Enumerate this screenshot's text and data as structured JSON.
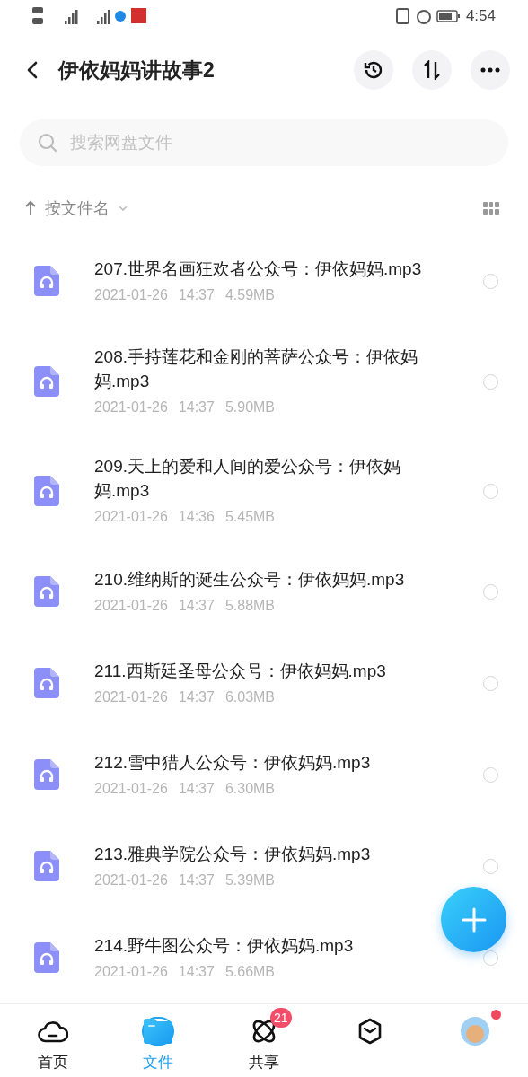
{
  "status_bar": {
    "time": "4:54"
  },
  "header": {
    "title": "伊依妈妈讲故事2"
  },
  "search": {
    "placeholder": "搜索网盘文件"
  },
  "sort": {
    "label": "按文件名"
  },
  "files": [
    {
      "name": "207.世界名画狂欢者公众号：伊依妈妈.mp3",
      "date": "2021-01-26",
      "time": "14:37",
      "size": "4.59MB",
      "selected": false
    },
    {
      "name": "208.手持莲花和金刚的菩萨公众号：伊依妈妈.mp3",
      "date": "2021-01-26",
      "time": "14:37",
      "size": "5.90MB",
      "selected": false
    },
    {
      "name": "209.天上的爱和人间的爱公众号：伊依妈妈.mp3",
      "date": "2021-01-26",
      "time": "14:36",
      "size": "5.45MB",
      "selected": false
    },
    {
      "name": "210.维纳斯的诞生公众号：伊依妈妈.mp3",
      "date": "2021-01-26",
      "time": "14:37",
      "size": "5.88MB",
      "selected": false
    },
    {
      "name": "211.西斯廷圣母公众号：伊依妈妈.mp3",
      "date": "2021-01-26",
      "time": "14:37",
      "size": "6.03MB",
      "selected": false
    },
    {
      "name": "212.雪中猎人公众号：伊依妈妈.mp3",
      "date": "2021-01-26",
      "time": "14:37",
      "size": "6.30MB",
      "selected": false
    },
    {
      "name": "213.雅典学院公众号：伊依妈妈.mp3",
      "date": "2021-01-26",
      "time": "14:37",
      "size": "5.39MB",
      "selected": false
    },
    {
      "name": "214.野牛图公众号：伊依妈妈.mp3",
      "date": "2021-01-26",
      "time": "14:37",
      "size": "5.66MB",
      "selected": false
    }
  ],
  "nav": [
    {
      "kind": "home",
      "label": "首页",
      "selected": false
    },
    {
      "kind": "files",
      "label": "文件",
      "selected": true
    },
    {
      "kind": "share",
      "label": "共享",
      "selected": false,
      "badge": "21"
    },
    {
      "kind": "box",
      "selected": false
    },
    {
      "kind": "avatar",
      "selected": false,
      "dot": true
    }
  ]
}
